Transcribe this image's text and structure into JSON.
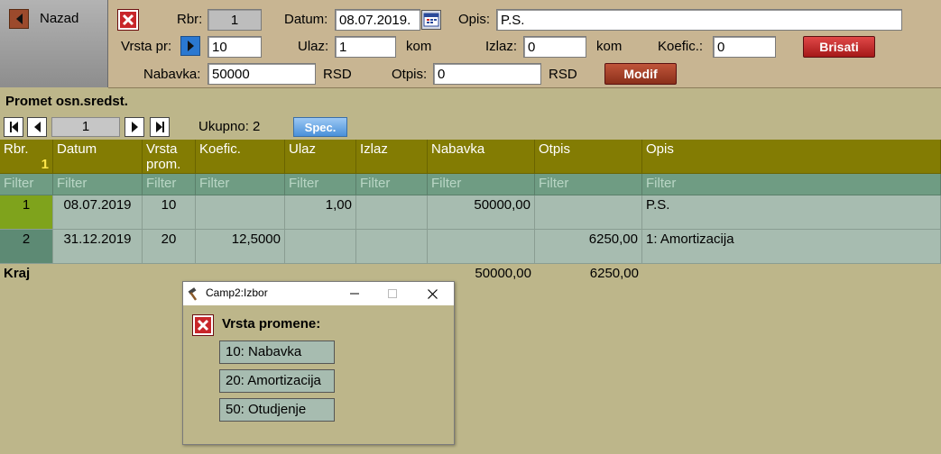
{
  "nav": {
    "back_label": "Nazad"
  },
  "form": {
    "rbr_label": "Rbr:",
    "rbr_value": "1",
    "datum_label": "Datum:",
    "datum_value": "08.07.2019.",
    "opis_label": "Opis:",
    "opis_value": "P.S.",
    "vrsta_label": "Vrsta pr:",
    "vrsta_value": "10",
    "ulaz_label": "Ulaz:",
    "ulaz_value": "1",
    "ulaz_unit": "kom",
    "izlaz_label": "Izlaz:",
    "izlaz_value": "0",
    "izlaz_unit": "kom",
    "koefic_label": "Koefic.:",
    "koefic_value": "0",
    "brisati_label": "Brisati",
    "nabavka_label": "Nabavka:",
    "nabavka_value": "50000",
    "nabavka_unit": "RSD",
    "otpis_label": "Otpis:",
    "otpis_value": "0",
    "otpis_unit": "RSD",
    "modif_label": "Modif"
  },
  "section": {
    "title": "Promet osn.sredst.",
    "page_value": "1",
    "total_label": "Ukupno: 2",
    "spec_label": "Spec."
  },
  "grid": {
    "headers": {
      "rbr": "Rbr.",
      "rbr_sort": "1",
      "datum": "Datum",
      "vrsta": "Vrsta prom.",
      "koefic": "Koefic.",
      "ulaz": "Ulaz",
      "izlaz": "Izlaz",
      "nabavka": "Nabavka",
      "otpis": "Otpis",
      "opis": "Opis"
    },
    "filter_placeholder": "Filter",
    "rows": [
      {
        "rbr": "1",
        "datum": "08.07.2019",
        "vrsta": "10",
        "koefic": "",
        "ulaz": "1,00",
        "izlaz": "",
        "nabavka": "50000,00",
        "otpis": "",
        "opis": "P.S."
      },
      {
        "rbr": "2",
        "datum": "31.12.2019",
        "vrsta": "20",
        "koefic": "12,5000",
        "ulaz": "",
        "izlaz": "",
        "nabavka": "",
        "otpis": "6250,00",
        "opis": "1: Amortizacija"
      }
    ],
    "footer": {
      "label": "Kraj",
      "nabavka_total": "50000,00",
      "otpis_total": "6250,00"
    }
  },
  "dialog": {
    "window_title": "Camp2:Izbor",
    "prompt": "Vrsta promene:",
    "options": [
      "10: Nabavka",
      "20: Amortizacija",
      "50: Otudjenje"
    ]
  },
  "colors": {
    "header_bg": "#837c03",
    "filter_bg": "#6f9c83",
    "row_bg": "#a7bcb0",
    "selected_rbr": "#7fa31c",
    "page_bg": "#bdb68a"
  }
}
